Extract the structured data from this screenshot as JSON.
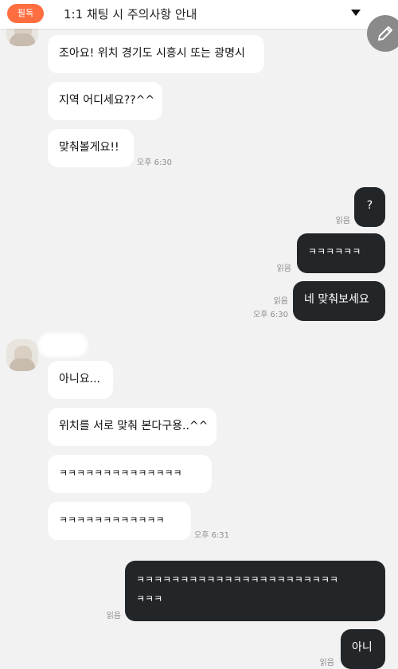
{
  "notice": {
    "badge": "필독",
    "title": "1:1 채팅 시 주의사항 안내"
  },
  "messages": {
    "m1": "조아요! 위치 경기도 시흥시 또는 광명시",
    "m2": "지역 어디세요??^^",
    "m3": "맞춰볼게요!!",
    "m3_time": "오후 6:30",
    "m4": "?",
    "m4_read": "읽음",
    "m5": "ㅋㅋㅋㅋㅋㅋ",
    "m5_read": "읽음",
    "m6": "네 맞춰보세요",
    "m6_read": "읽음",
    "m6_time": "오후 6:30",
    "m7": "아니요...",
    "m8": "위치를 서로 맞춰 본다구용..^^",
    "m9": "ㅋㅋㅋㅋㅋㅋㅋㅋㅋㅋㅋㅋㅋㅋ",
    "m10": "ㅋㅋㅋㅋㅋㅋㅋㅋㅋㅋㅋㅋ",
    "m10_time": "오후 6:31",
    "m11_line1": "ㅋㅋㅋㅋㅋㅋㅋㅋㅋㅋㅋㅋㅋㅋㅋㅋㅋㅋㅋㅋㅋㅋㅋ",
    "m11_line2": "ㅋㅋㅋ",
    "m11_read": "읽음",
    "m12": "아니",
    "m12_read": "읽음"
  },
  "colors": {
    "background": "#f2f2f2",
    "badge": "#ff6e40",
    "incoming_bubble": "#ffffff",
    "outgoing_bubble": "#232629"
  },
  "icons": {
    "notice_toggle": "chevron-down-icon",
    "compose": "pencil-icon"
  }
}
